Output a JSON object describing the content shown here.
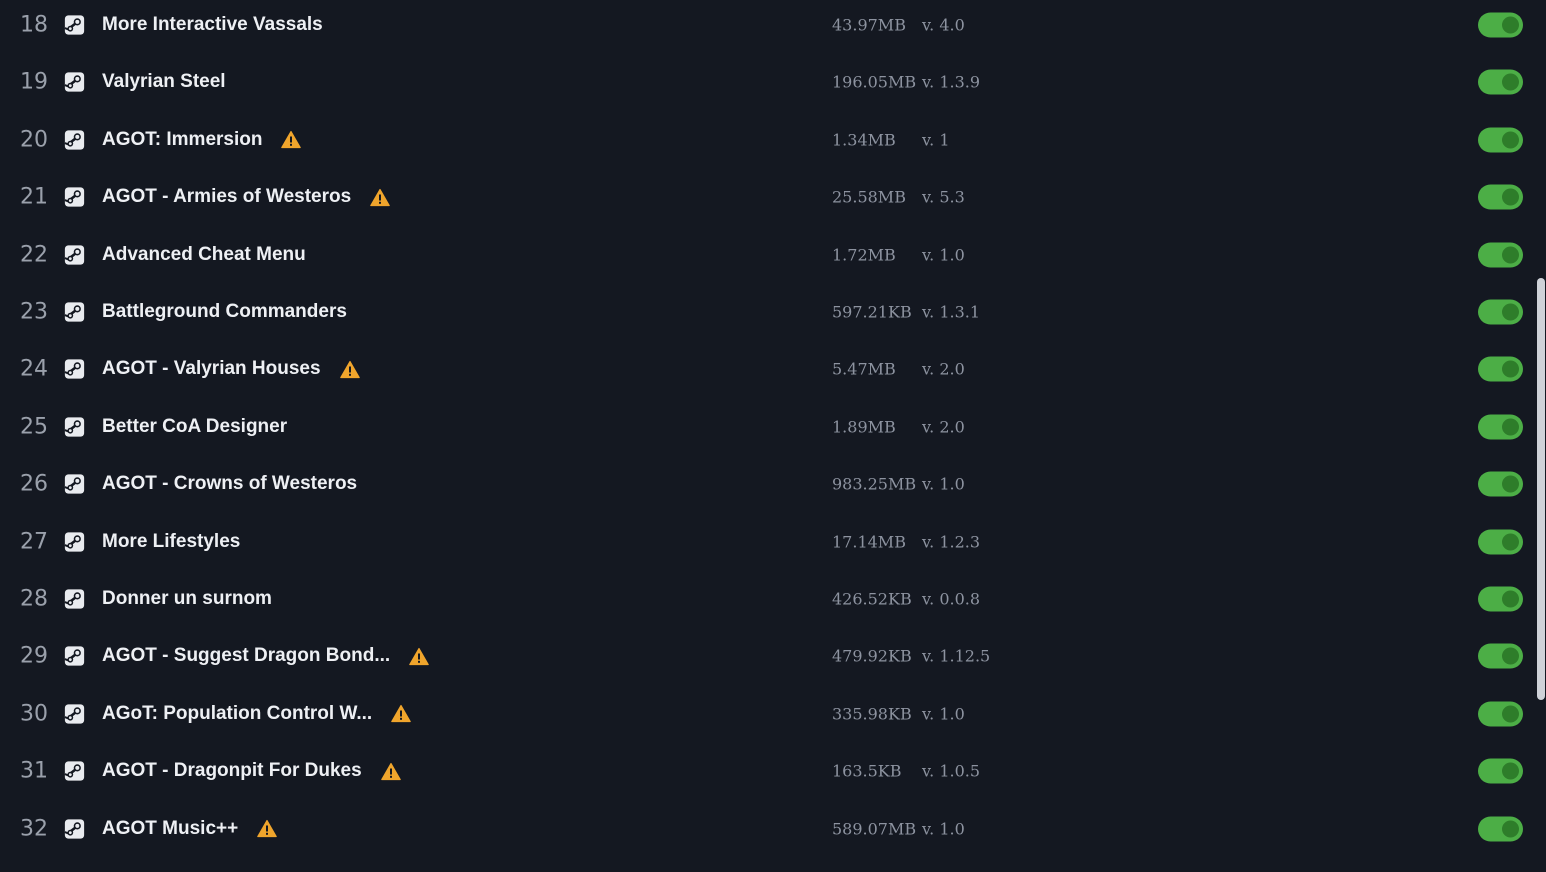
{
  "mods": [
    {
      "index": "18",
      "name": "More Interactive Vassals",
      "warning": false,
      "size": "43.97MB",
      "version": "v. 4.0",
      "enabled": true
    },
    {
      "index": "19",
      "name": "Valyrian Steel",
      "warning": false,
      "size": "196.05MB",
      "version": "v. 1.3.9",
      "enabled": true
    },
    {
      "index": "20",
      "name": "AGOT: Immersion",
      "warning": true,
      "size": "1.34MB",
      "version": "v. 1",
      "enabled": true
    },
    {
      "index": "21",
      "name": "AGOT - Armies of Westeros",
      "warning": true,
      "size": "25.58MB",
      "version": "v. 5.3",
      "enabled": true
    },
    {
      "index": "22",
      "name": "Advanced Cheat Menu",
      "warning": false,
      "size": "1.72MB",
      "version": "v. 1.0",
      "enabled": true
    },
    {
      "index": "23",
      "name": "Battleground Commanders",
      "warning": false,
      "size": "597.21KB",
      "version": "v. 1.3.1",
      "enabled": true
    },
    {
      "index": "24",
      "name": "AGOT - Valyrian Houses",
      "warning": true,
      "size": "5.47MB",
      "version": "v. 2.0",
      "enabled": true
    },
    {
      "index": "25",
      "name": "Better CoA Designer",
      "warning": false,
      "size": "1.89MB",
      "version": "v. 2.0",
      "enabled": true
    },
    {
      "index": "26",
      "name": "AGOT - Crowns of Westeros",
      "warning": false,
      "size": "983.25MB",
      "version": "v. 1.0",
      "enabled": true
    },
    {
      "index": "27",
      "name": "More Lifestyles",
      "warning": false,
      "size": "17.14MB",
      "version": "v. 1.2.3",
      "enabled": true
    },
    {
      "index": "28",
      "name": "Donner un surnom",
      "warning": false,
      "size": "426.52KB",
      "version": "v. 0.0.8",
      "enabled": true
    },
    {
      "index": "29",
      "name": "AGOT - Suggest Dragon Bond...",
      "warning": true,
      "size": "479.92KB",
      "version": "v. 1.12.5",
      "enabled": true
    },
    {
      "index": "30",
      "name": "AGoT: Population Control W...",
      "warning": true,
      "size": "335.98KB",
      "version": "v. 1.0",
      "enabled": true
    },
    {
      "index": "31",
      "name": "AGOT - Dragonpit For Dukes",
      "warning": true,
      "size": "163.5KB",
      "version": "v. 1.0.5",
      "enabled": true
    },
    {
      "index": "32",
      "name": "AGOT Music++",
      "warning": true,
      "size": "589.07MB",
      "version": "v. 1.0",
      "enabled": true
    }
  ],
  "colors": {
    "background": "#141821",
    "toggle_on": "#4cae46",
    "warning": "#f0a52c"
  },
  "icons": {
    "source": "steam-icon",
    "warning": "warning-icon"
  }
}
